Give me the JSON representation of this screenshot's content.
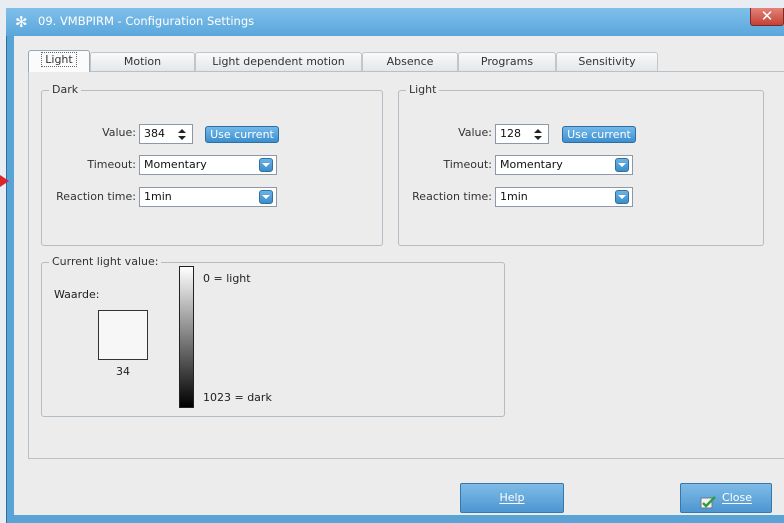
{
  "window": {
    "title": "09. VMBPIRM - Configuration Settings",
    "close_symbol": "✕"
  },
  "tabs": [
    {
      "label": "Light"
    },
    {
      "label": "Motion"
    },
    {
      "label": "Light dependent motion"
    },
    {
      "label": "Absence"
    },
    {
      "label": "Programs"
    },
    {
      "label": "Sensitivity"
    }
  ],
  "active_tab": "Light",
  "dark": {
    "legend": "Dark",
    "value_label": "Value:",
    "value": "384",
    "use_current": "Use current",
    "timeout_label": "Timeout:",
    "timeout": "Momentary",
    "reaction_label": "Reaction time:",
    "reaction": "1min"
  },
  "light": {
    "legend": "Light",
    "value_label": "Value:",
    "value": "128",
    "use_current": "Use current",
    "timeout_label": "Timeout:",
    "timeout": "Momentary",
    "reaction_label": "Reaction time:",
    "reaction": "1min"
  },
  "current": {
    "legend": "Current light value:",
    "waarde_label": "Waarde:",
    "reading": "34",
    "scale_top": "0 = light",
    "scale_bottom": "1023 = dark"
  },
  "buttons": {
    "help": "Help",
    "close": "Close"
  },
  "colors": {
    "titlebar": "#5aa6dc",
    "accent_button": "#4d96d2",
    "close_x": "#c64134"
  }
}
